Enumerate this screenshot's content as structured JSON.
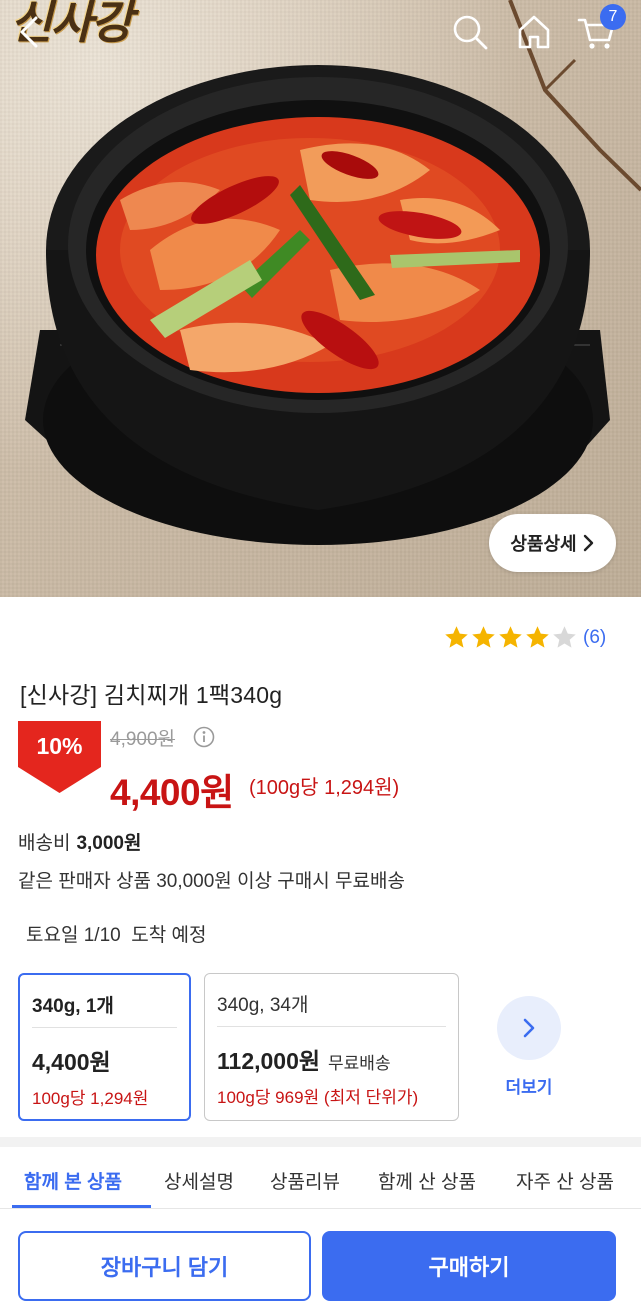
{
  "header": {
    "brand": "신사강",
    "cart_count": "7",
    "icons": [
      "back-arrow-icon",
      "search-icon",
      "home-icon",
      "cart-icon"
    ]
  },
  "hero": {
    "detail_button_label": "상품상세"
  },
  "product": {
    "rating_stars": 4,
    "rating_max": 5,
    "review_count": "(6)",
    "title": "[신사강] 김치찌개 1팩340g",
    "discount": "10%",
    "original_price": "4,900원",
    "sale_price": "4,400원",
    "unit_price": "(100g당 1,294원)"
  },
  "shipping": {
    "label": "배송비",
    "fee": "3,000원",
    "free_note": "같은 판매자 상품 30,000원 이상 구매시 무료배송",
    "arrival": "토요일 1/10  도착 예정"
  },
  "options": [
    {
      "name": "340g, 1개",
      "price": "4,400원",
      "shipping": "",
      "unit": "100g당 1,294원",
      "selected": true
    },
    {
      "name": "340g, 34개",
      "price": "112,000원",
      "shipping": "무료배송",
      "unit": "100g당 969원 (최저 단위가)",
      "selected": false
    }
  ],
  "more_label": "더보기",
  "tabs": [
    "함께 본 상품",
    "상세설명",
    "상품리뷰",
    "함께 산 상품",
    "자주 산 상품"
  ],
  "active_tab": 0,
  "bottom": {
    "cart_button": "장바구니 담기",
    "buy_button": "구매하기"
  },
  "colors": {
    "accent": "#3b6cf0",
    "sale": "#c81414",
    "discount_badge": "#e4261e"
  }
}
